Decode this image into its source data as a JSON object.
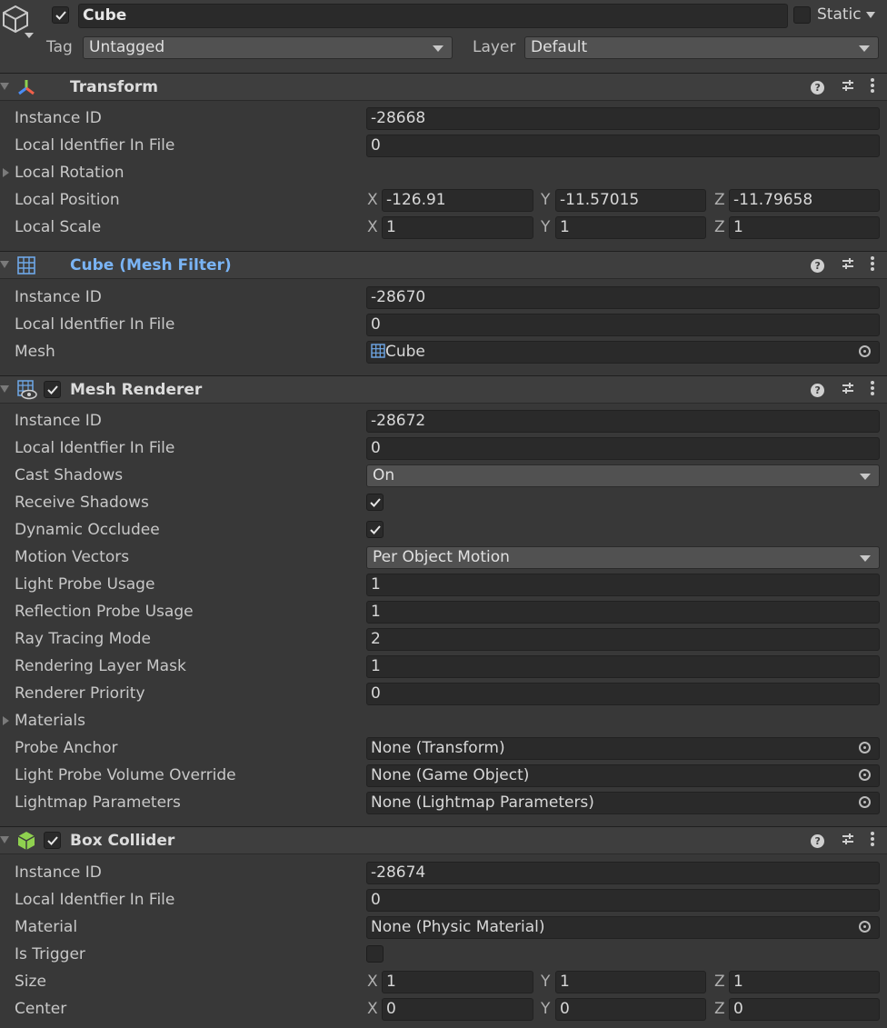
{
  "object": {
    "name": "Cube",
    "static_label": "Static",
    "tag_label": "Tag",
    "tag_value": "Untagged",
    "layer_label": "Layer",
    "layer_value": "Default"
  },
  "transform": {
    "title": "Transform",
    "instance_id_label": "Instance ID",
    "instance_id": "-28668",
    "local_id_label": "Local Identfier In File",
    "local_id": "0",
    "local_rotation_label": "Local Rotation",
    "local_position_label": "Local Position",
    "local_position": {
      "x": "-126.91",
      "y": "-11.57015",
      "z": "-11.79658"
    },
    "local_scale_label": "Local Scale",
    "local_scale": {
      "x": "1",
      "y": "1",
      "z": "1"
    }
  },
  "axis": {
    "x": "X",
    "y": "Y",
    "z": "Z"
  },
  "mesh_filter": {
    "title": "Cube (Mesh Filter)",
    "instance_id_label": "Instance ID",
    "instance_id": "-28670",
    "local_id_label": "Local Identfier In File",
    "local_id": "0",
    "mesh_label": "Mesh",
    "mesh_value": "Cube"
  },
  "mesh_renderer": {
    "title": "Mesh Renderer",
    "instance_id_label": "Instance ID",
    "instance_id": "-28672",
    "local_id_label": "Local Identfier In File",
    "local_id": "0",
    "cast_shadows_label": "Cast Shadows",
    "cast_shadows": "On",
    "receive_shadows_label": "Receive Shadows",
    "dynamic_occludee_label": "Dynamic Occludee",
    "motion_vectors_label": "Motion Vectors",
    "motion_vectors": "Per Object Motion",
    "light_probe_usage_label": "Light Probe Usage",
    "light_probe_usage": "1",
    "reflection_probe_usage_label": "Reflection Probe Usage",
    "reflection_probe_usage": "1",
    "ray_tracing_mode_label": "Ray Tracing Mode",
    "ray_tracing_mode": "2",
    "rendering_layer_mask_label": "Rendering Layer Mask",
    "rendering_layer_mask": "1",
    "renderer_priority_label": "Renderer Priority",
    "renderer_priority": "0",
    "materials_label": "Materials",
    "probe_anchor_label": "Probe Anchor",
    "probe_anchor": "None (Transform)",
    "light_probe_volume_override_label": "Light Probe Volume Override",
    "light_probe_volume_override": "None (Game Object)",
    "lightmap_parameters_label": "Lightmap Parameters",
    "lightmap_parameters": "None (Lightmap Parameters)"
  },
  "box_collider": {
    "title": "Box Collider",
    "instance_id_label": "Instance ID",
    "instance_id": "-28674",
    "local_id_label": "Local Identfier In File",
    "local_id": "0",
    "material_label": "Material",
    "material": "None (Physic Material)",
    "is_trigger_label": "Is Trigger",
    "size_label": "Size",
    "size": {
      "x": "1",
      "y": "1",
      "z": "1"
    },
    "center_label": "Center",
    "center": {
      "x": "0",
      "y": "0",
      "z": "0"
    }
  },
  "colors": {
    "accent_blue": "#7ab4f5",
    "background": "#383838",
    "field": "#2a2a2a"
  }
}
